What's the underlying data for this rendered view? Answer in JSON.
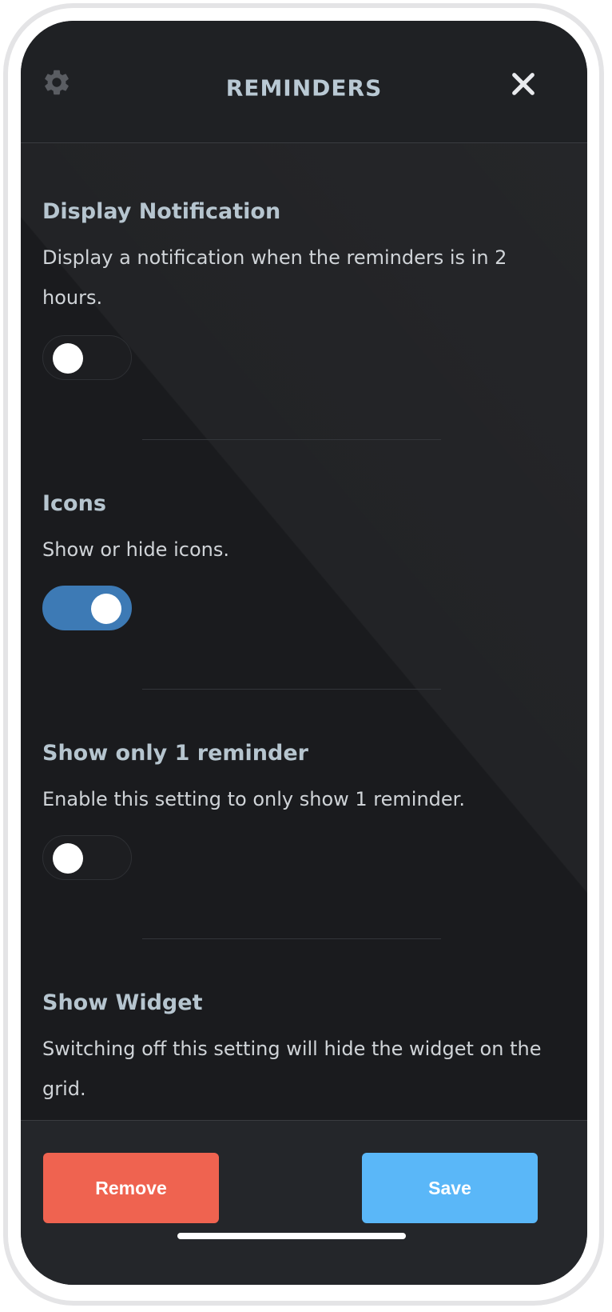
{
  "header": {
    "title": "REMINDERS",
    "settings_icon": "gear-icon",
    "close_icon": "close-icon"
  },
  "settings": [
    {
      "title": "Display Notification",
      "description": "Display a notification when the reminders is in 2 hours.",
      "enabled": false
    },
    {
      "title": "Icons",
      "description": "Show or hide icons.",
      "enabled": true
    },
    {
      "title": "Show only 1 reminder",
      "description": "Enable this setting to only show 1 reminder.",
      "enabled": false
    },
    {
      "title": "Show Widget",
      "description": "Switching off this setting will hide the widget on the grid."
    }
  ],
  "footer": {
    "remove_label": "Remove",
    "save_label": "Save"
  },
  "colors": {
    "background": "#1a1b1e",
    "title_text": "#b9c9d4",
    "toggle_on": "#3d7ab5",
    "remove_button": "#ef6350",
    "save_button": "#5ab7f8"
  }
}
